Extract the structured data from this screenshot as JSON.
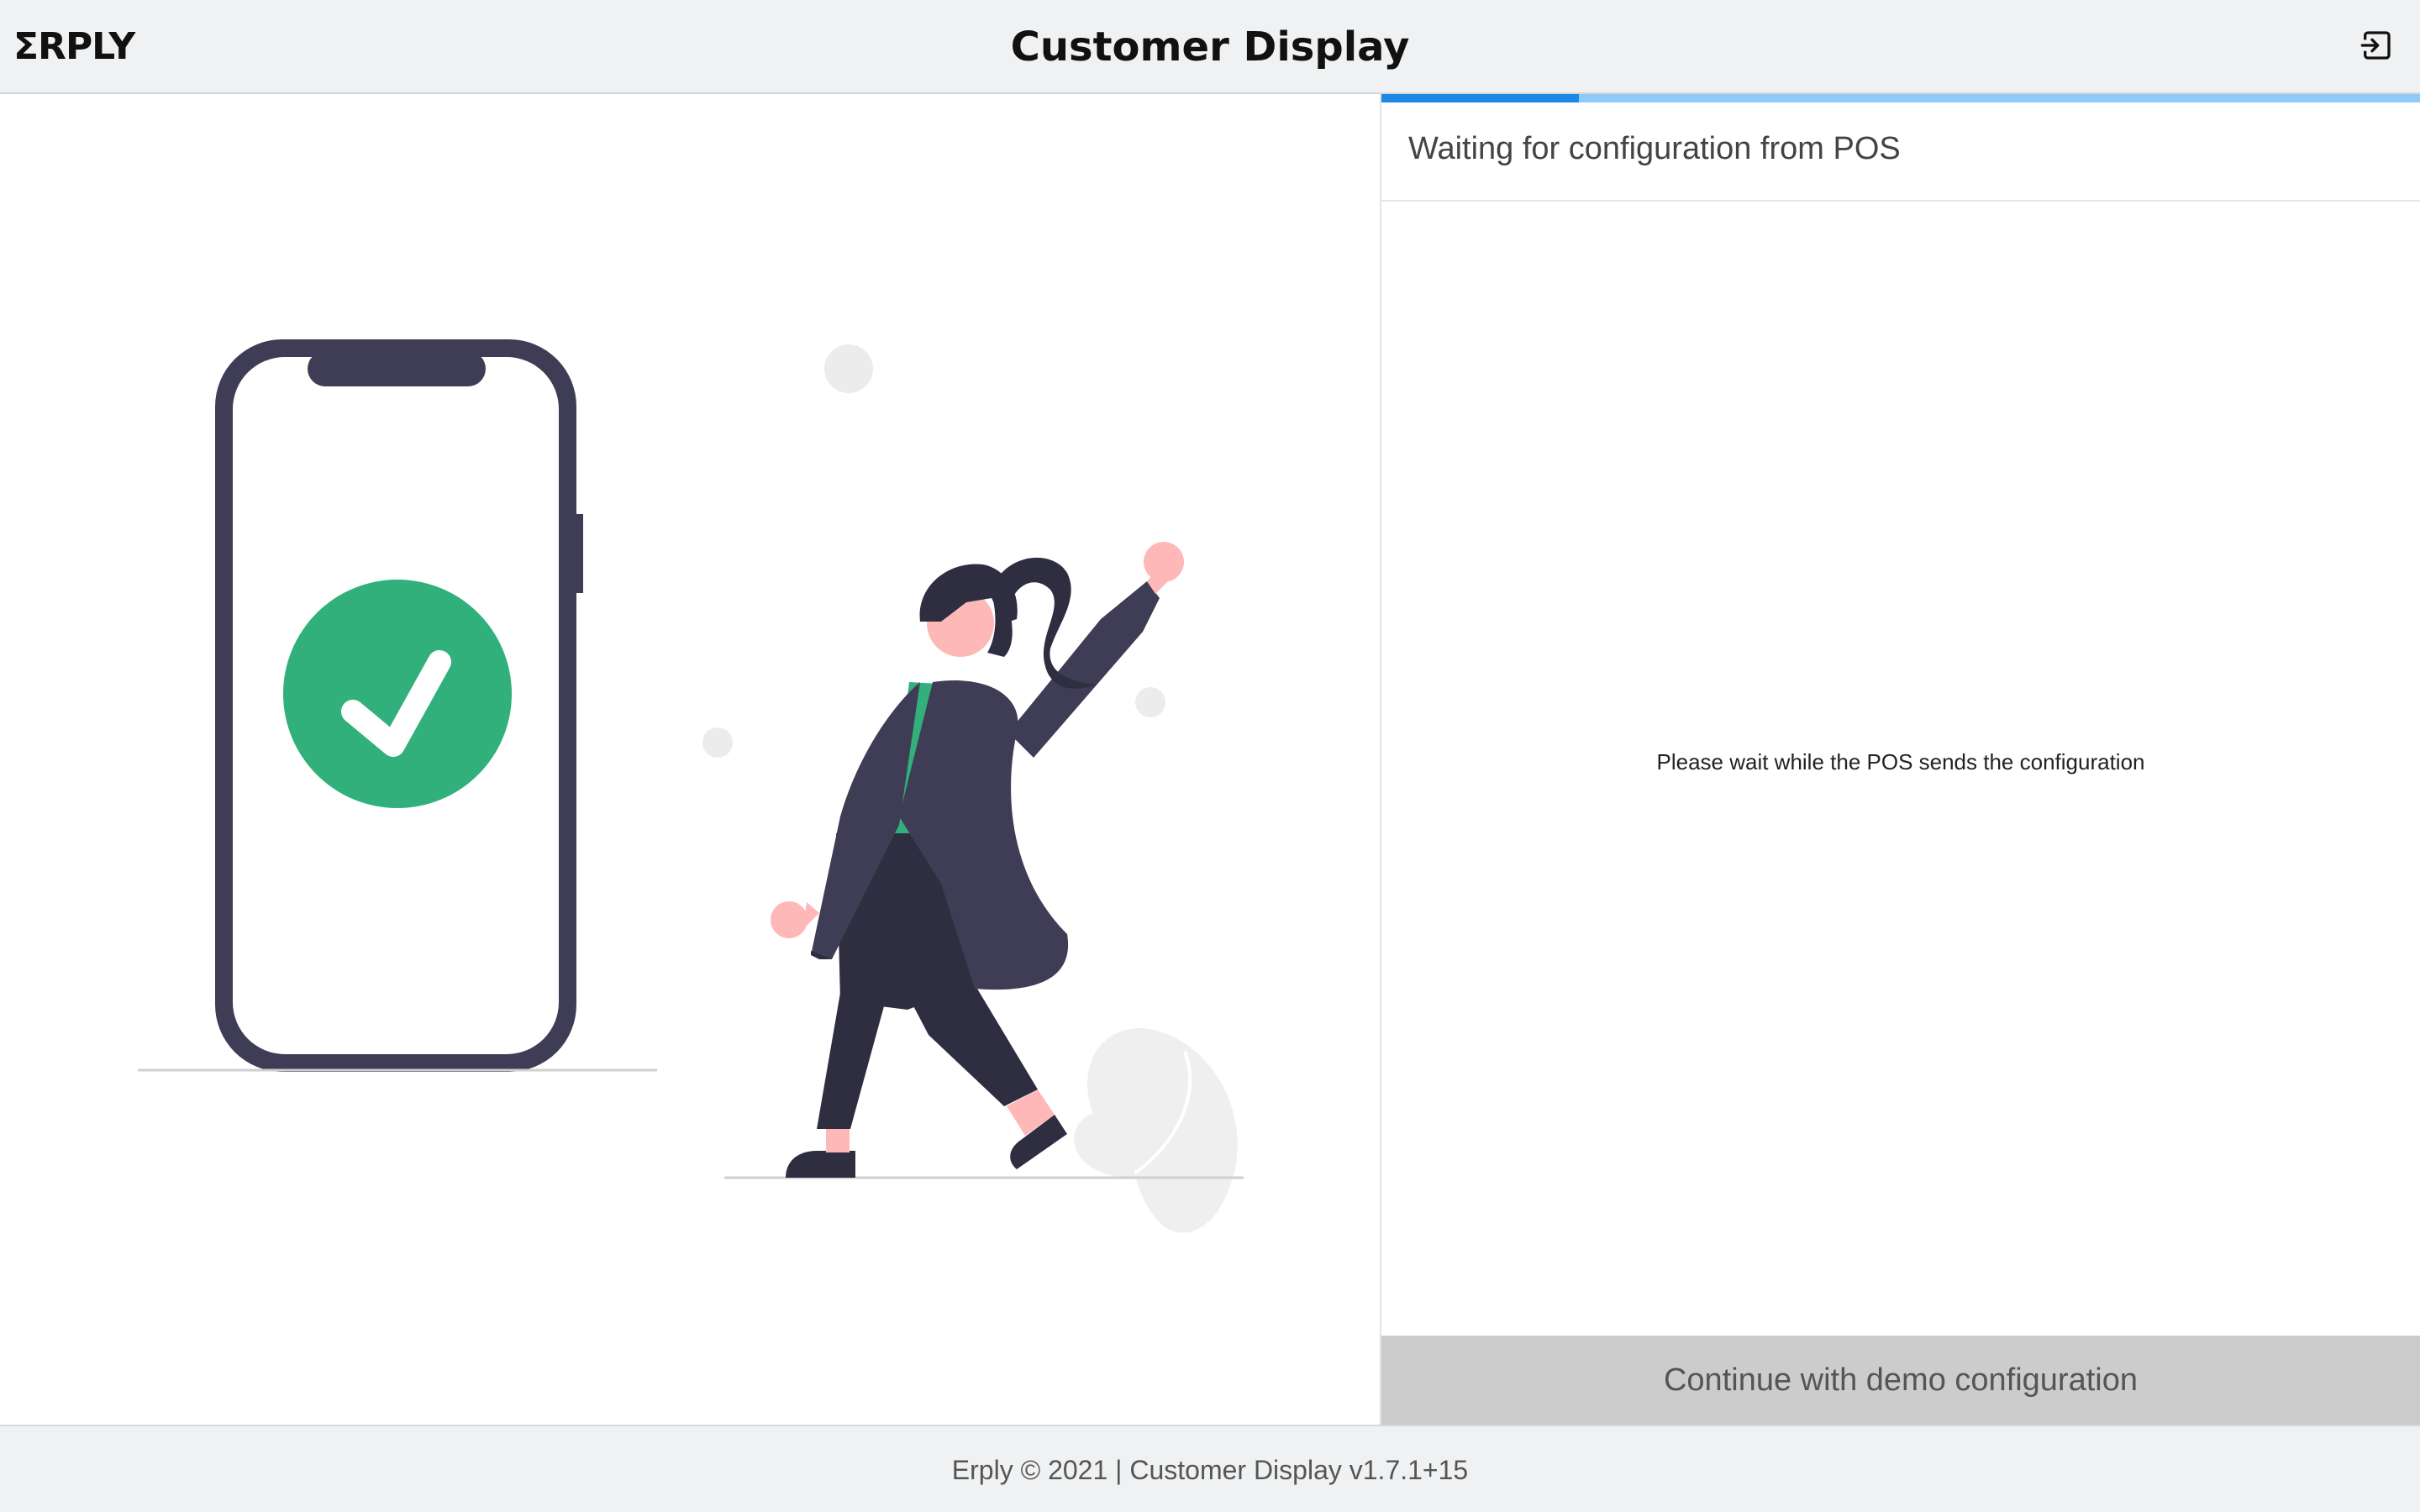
{
  "header": {
    "logo_text": "ΣRPLY",
    "title": "Customer Display",
    "exit_icon": "exit-icon"
  },
  "illustration": {
    "phone_icon": "phone-icon",
    "check_icon": "checkmark-icon",
    "figure": "person-celebrating",
    "accent_color": "#31b07c",
    "phone_color": "#3f3d56"
  },
  "panel": {
    "progress_value": 0.19,
    "heading": "Waiting for configuration from POS",
    "message": "Please wait while the POS sends the configuration",
    "demo_button_label": "Continue with demo configuration"
  },
  "footer": {
    "text": "Erply © 2021 | Customer Display v1.7.1+15"
  },
  "colors": {
    "progress_fill": "#1e88e5",
    "progress_track": "#90caf9",
    "button_bg": "#cccccc"
  }
}
